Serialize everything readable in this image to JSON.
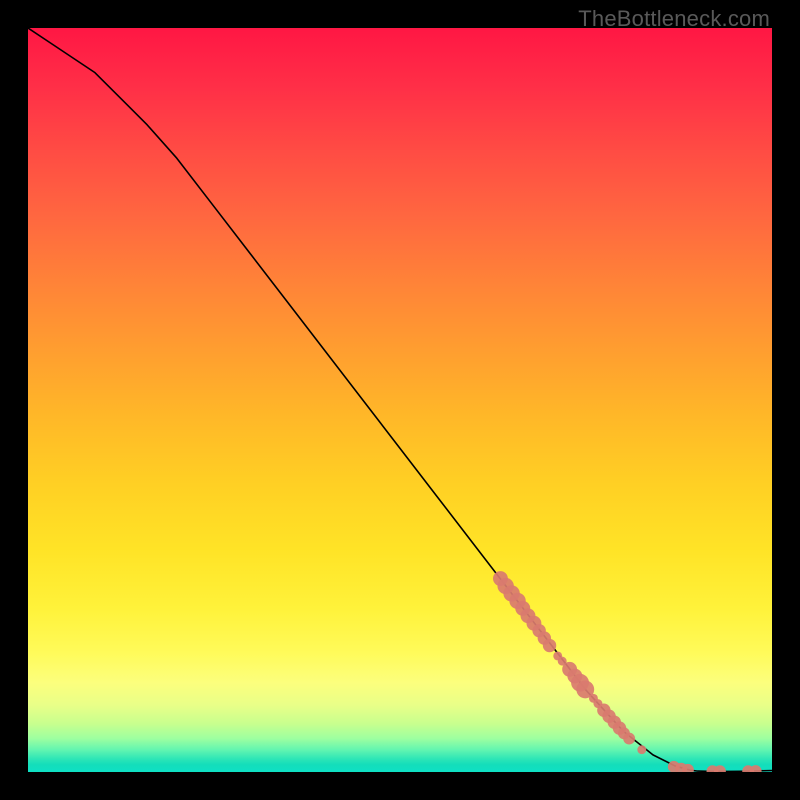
{
  "watermark": "TheBottleneck.com",
  "chart_data": {
    "type": "line",
    "title": "",
    "xlabel": "",
    "ylabel": "",
    "xlim": [
      0,
      100
    ],
    "ylim": [
      0,
      100
    ],
    "grid": false,
    "legend": false,
    "series": [
      {
        "name": "curve",
        "style": "line",
        "color": "#000000",
        "x": [
          0,
          3,
          6,
          9,
          12,
          16,
          20,
          25,
          30,
          35,
          40,
          45,
          50,
          55,
          60,
          65,
          70,
          75,
          80,
          84,
          87,
          89,
          90,
          92,
          94,
          96,
          98,
          100
        ],
        "y": [
          100,
          98,
          96,
          94,
          91,
          87,
          82.5,
          76,
          69.5,
          63,
          56.5,
          50,
          43.5,
          37,
          30.5,
          24,
          17.5,
          11,
          5.5,
          2.3,
          0.8,
          0.25,
          0.12,
          0.08,
          0.08,
          0.1,
          0.15,
          0.2
        ]
      },
      {
        "name": "scatter-points",
        "style": "scatter",
        "color": "#d97b6f",
        "points": [
          {
            "x": 63.5,
            "y": 26.0,
            "r": 1.0
          },
          {
            "x": 64.2,
            "y": 25.0,
            "r": 1.1
          },
          {
            "x": 65.0,
            "y": 24.0,
            "r": 1.1
          },
          {
            "x": 65.8,
            "y": 23.0,
            "r": 1.1
          },
          {
            "x": 66.5,
            "y": 22.0,
            "r": 1.0
          },
          {
            "x": 67.2,
            "y": 21.0,
            "r": 1.0
          },
          {
            "x": 68.0,
            "y": 20.0,
            "r": 1.0
          },
          {
            "x": 68.7,
            "y": 19.0,
            "r": 0.9
          },
          {
            "x": 69.4,
            "y": 18.0,
            "r": 0.9
          },
          {
            "x": 70.1,
            "y": 17.0,
            "r": 0.9
          },
          {
            "x": 71.2,
            "y": 15.6,
            "r": 0.6
          },
          {
            "x": 71.8,
            "y": 14.9,
            "r": 0.6
          },
          {
            "x": 72.8,
            "y": 13.8,
            "r": 1.0
          },
          {
            "x": 73.5,
            "y": 12.9,
            "r": 1.0
          },
          {
            "x": 74.2,
            "y": 12.0,
            "r": 1.2
          },
          {
            "x": 74.9,
            "y": 11.1,
            "r": 1.2
          },
          {
            "x": 76.0,
            "y": 9.9,
            "r": 0.6
          },
          {
            "x": 76.6,
            "y": 9.2,
            "r": 0.6
          },
          {
            "x": 77.4,
            "y": 8.3,
            "r": 0.9
          },
          {
            "x": 78.1,
            "y": 7.5,
            "r": 0.9
          },
          {
            "x": 78.8,
            "y": 6.7,
            "r": 0.9
          },
          {
            "x": 79.5,
            "y": 5.9,
            "r": 0.9
          },
          {
            "x": 80.1,
            "y": 5.2,
            "r": 0.8
          },
          {
            "x": 80.8,
            "y": 4.5,
            "r": 0.8
          },
          {
            "x": 82.5,
            "y": 3.0,
            "r": 0.6
          },
          {
            "x": 86.8,
            "y": 0.7,
            "r": 0.8
          },
          {
            "x": 87.8,
            "y": 0.45,
            "r": 0.8
          },
          {
            "x": 88.7,
            "y": 0.3,
            "r": 0.8
          },
          {
            "x": 92.0,
            "y": 0.1,
            "r": 0.8
          },
          {
            "x": 93.0,
            "y": 0.1,
            "r": 0.8
          },
          {
            "x": 96.8,
            "y": 0.1,
            "r": 0.8
          },
          {
            "x": 97.8,
            "y": 0.12,
            "r": 0.8
          }
        ]
      }
    ]
  }
}
